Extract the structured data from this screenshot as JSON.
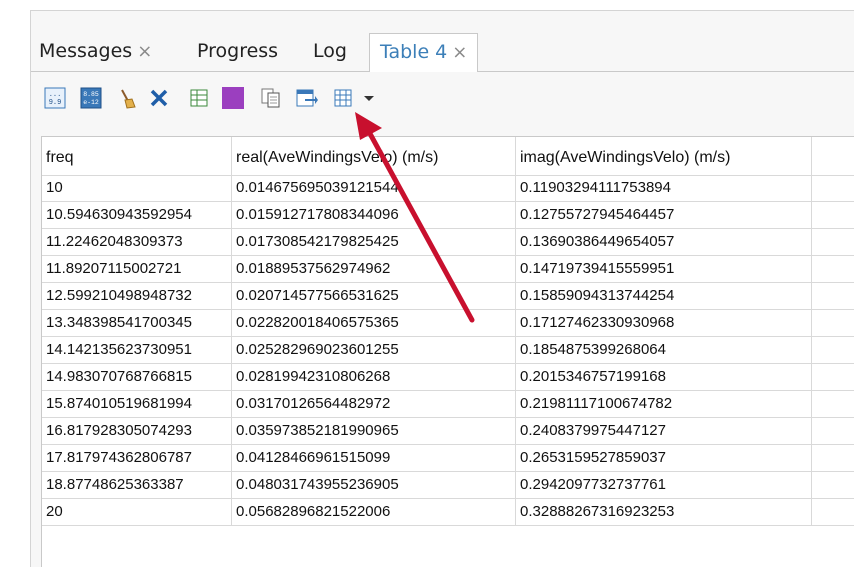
{
  "tabs": [
    {
      "label": "Messages",
      "closable": true,
      "active": false
    },
    {
      "label": "Progress",
      "closable": false,
      "active": false
    },
    {
      "label": "Log",
      "closable": false,
      "active": false
    },
    {
      "label": "Table 4",
      "closable": true,
      "active": true
    }
  ],
  "tab_close_glyph": "×",
  "toolbar_icons": [
    "full-precision-icon",
    "scientific-notation-icon",
    "clear-icon",
    "delete-icon",
    "select-all-icon",
    "color-swatch-icon",
    "copy-icon",
    "export-icon",
    "table-settings-icon",
    "dropdown-arrow-icon"
  ],
  "colors": {
    "accent_tab": "#3c7fb8",
    "swatch": "#9b3fbf",
    "delete": "#1f5ea8",
    "arrow": "#c8102e"
  },
  "table": {
    "headers": [
      "freq",
      "real(AveWindingsVelo) (m/s)",
      "imag(AveWindingsVelo) (m/s)",
      ""
    ],
    "rows": [
      [
        "10",
        "0.014675695039121544",
        "0.11903294111753894"
      ],
      [
        "10.594630943592954",
        "0.015912717808344096",
        "0.12755727945464457"
      ],
      [
        "11.22462048309373",
        "0.017308542179825425",
        "0.13690386449654057"
      ],
      [
        "11.89207115002721",
        "0.01889537562974962",
        "0.14719739415559951"
      ],
      [
        "12.599210498948732",
        "0.020714577566531625",
        "0.15859094313744254"
      ],
      [
        "13.348398541700345",
        "0.022820018406575365",
        "0.17127462330930968"
      ],
      [
        "14.142135623730951",
        "0.025282969023601255",
        "0.1854875399268064"
      ],
      [
        "14.983070768766815",
        "0.02819942310806268",
        "0.2015346757199168"
      ],
      [
        "15.874010519681994",
        "0.03170126564482972",
        "0.21981117100674782"
      ],
      [
        "16.817928305074293",
        "0.035973852181990965",
        "0.2408379975447127"
      ],
      [
        "17.817974362806787",
        "0.04128466961515099",
        "0.2653159527859037"
      ],
      [
        "18.87748625363387",
        "0.048031743955236905",
        "0.2942097732737761"
      ],
      [
        "20",
        "0.05682896821522006",
        "0.32888267316923253"
      ]
    ]
  }
}
